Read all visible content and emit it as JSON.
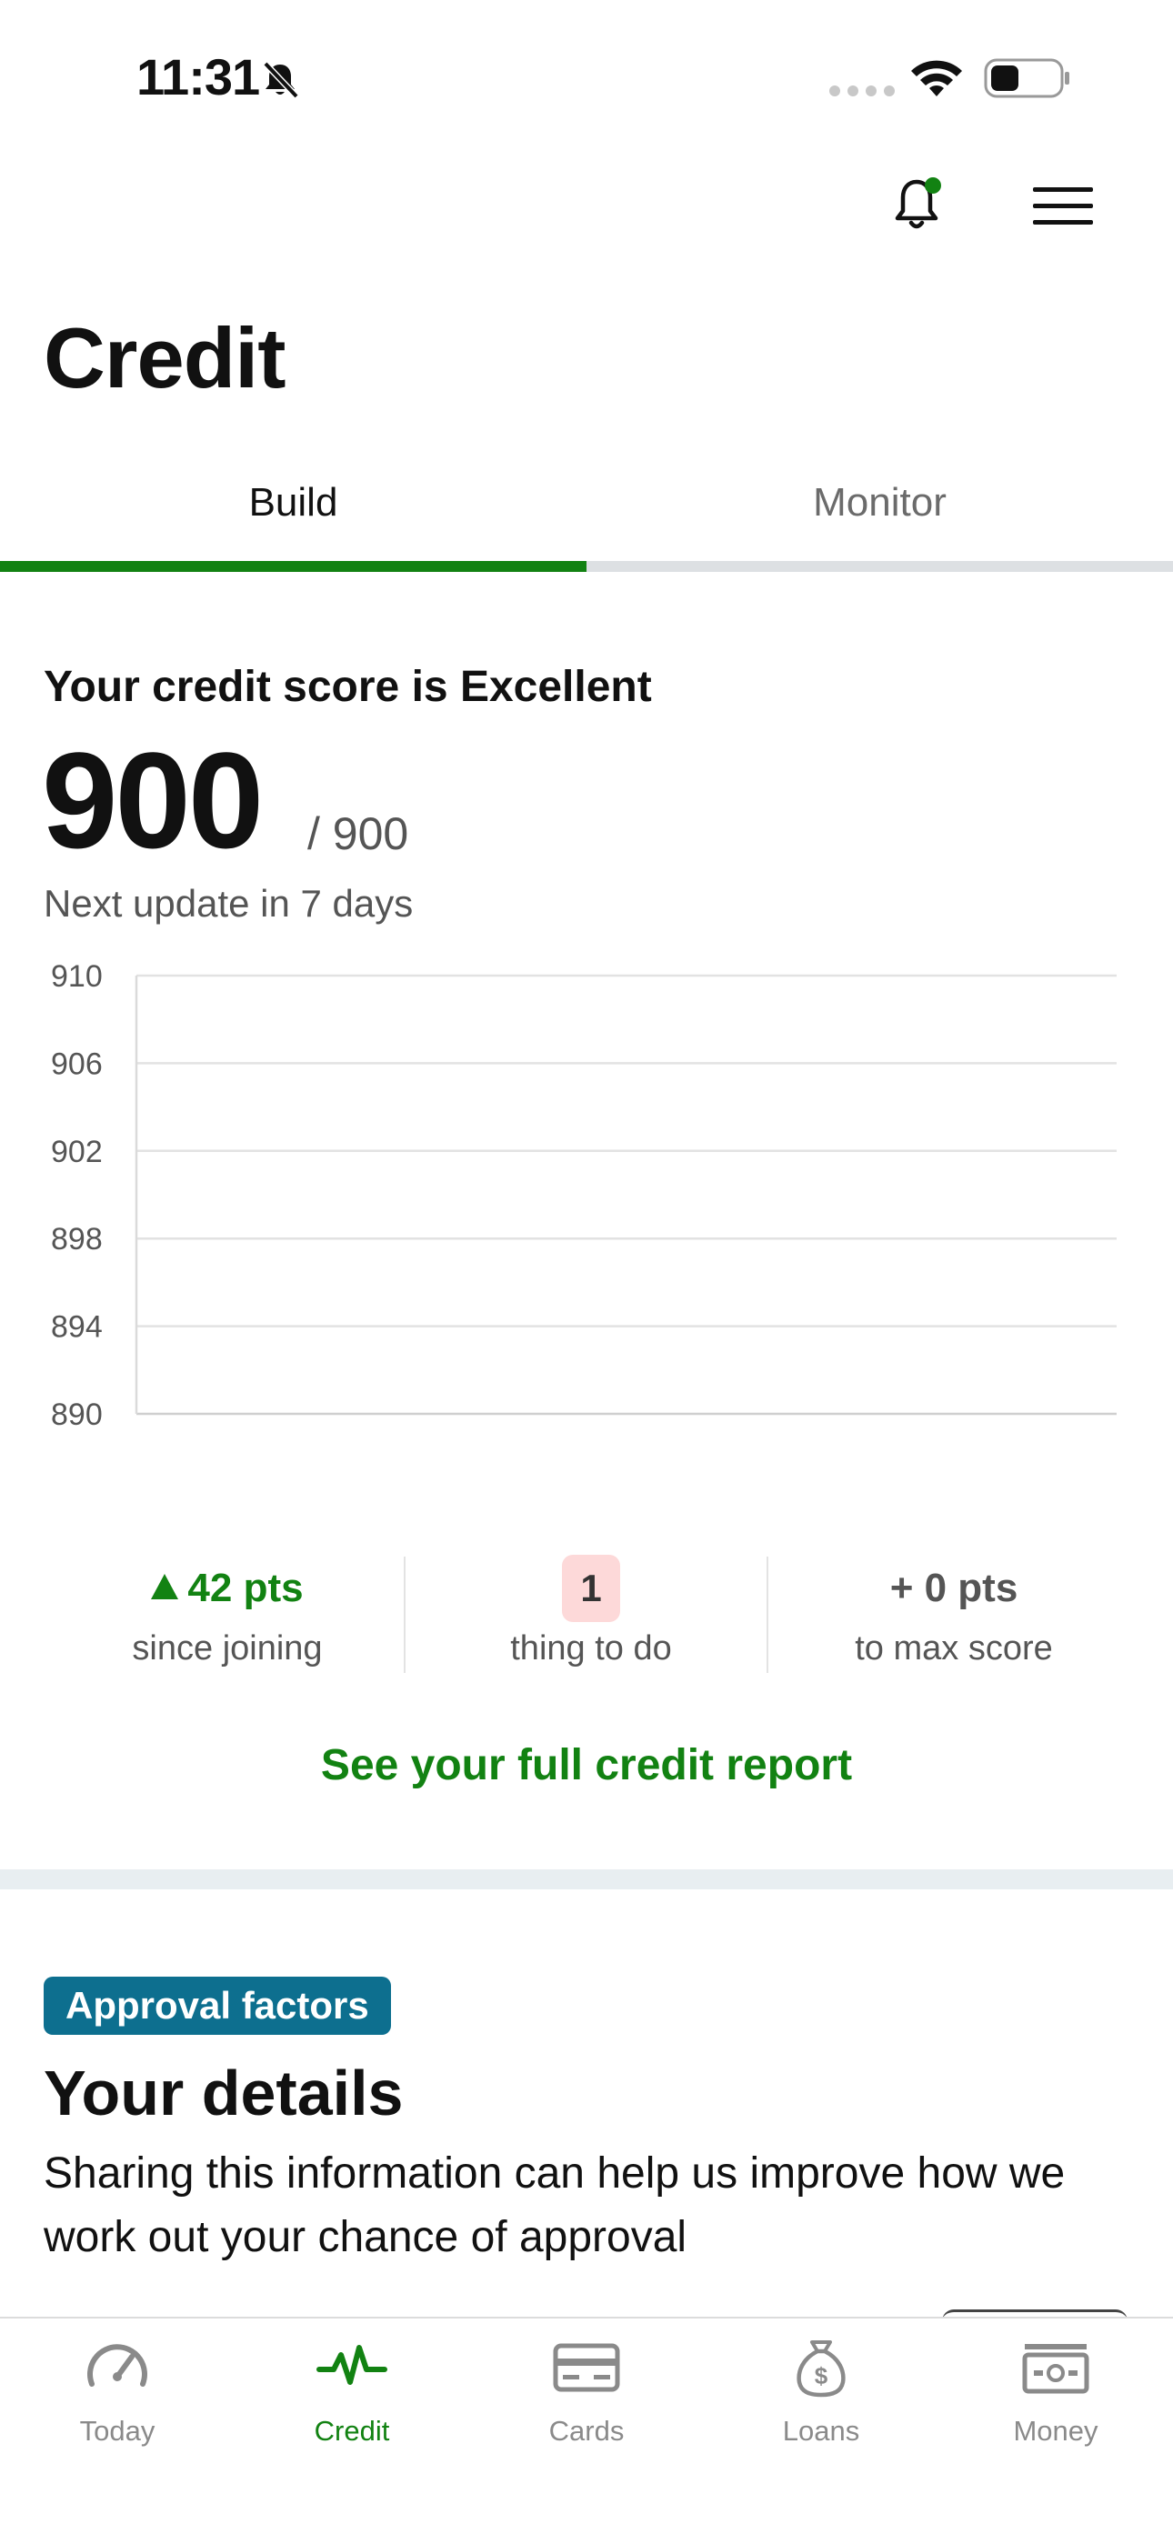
{
  "status_bar": {
    "time": "11:31"
  },
  "page": {
    "title": "Credit"
  },
  "tabs": [
    {
      "label": "Build",
      "active": true
    },
    {
      "label": "Monitor",
      "active": false
    }
  ],
  "score": {
    "heading": "Your credit score is Excellent",
    "value": "900",
    "max": "/ 900",
    "next_update": "Next update in 7 days"
  },
  "chart_data": {
    "type": "line",
    "y_ticks": [
      "910",
      "906",
      "902",
      "898",
      "894",
      "890"
    ],
    "ylim": [
      890,
      910
    ],
    "series": [],
    "grid": true
  },
  "stats": [
    {
      "main": "42 pts",
      "sub": "since joining",
      "icon": "up-triangle-icon"
    },
    {
      "main": "1",
      "sub": "thing to do"
    },
    {
      "main": "+ 0 pts",
      "sub": "to max score"
    }
  ],
  "links": {
    "full_report": "See your full credit report"
  },
  "approval": {
    "badge": "Approval factors",
    "title": "Your details",
    "description": "Sharing this information can help us improve how we work out your chance of approval"
  },
  "nav": [
    {
      "label": "Today",
      "icon": "speedometer-icon"
    },
    {
      "label": "Credit",
      "icon": "pulse-icon",
      "active": true
    },
    {
      "label": "Cards",
      "icon": "card-icon"
    },
    {
      "label": "Loans",
      "icon": "money-bag-icon"
    },
    {
      "label": "Money",
      "icon": "cash-icon"
    }
  ],
  "colors": {
    "accent_green": "#128212",
    "badge_teal": "#0d6f8f",
    "todo_badge_bg": "#fdd9d9",
    "section_gap": "#e8eef1"
  }
}
